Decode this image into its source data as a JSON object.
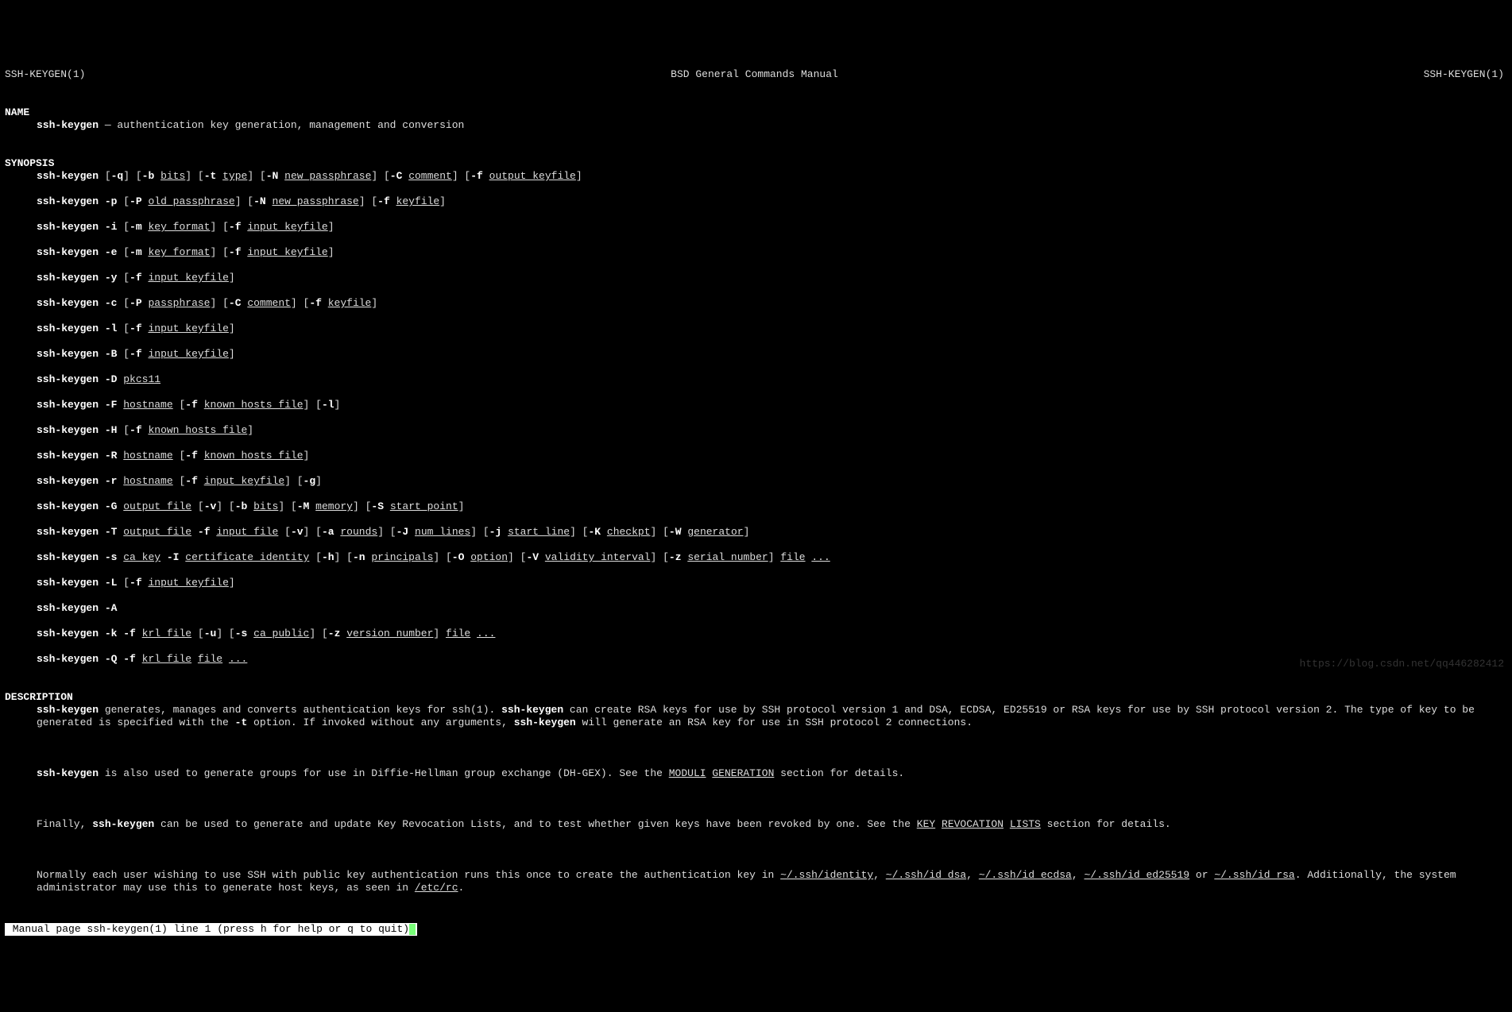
{
  "header": {
    "left": "SSH-KEYGEN(1)",
    "center": "BSD General Commands Manual",
    "right": "SSH-KEYGEN(1)"
  },
  "sections": {
    "name_hdr": "NAME",
    "name_cmd": "ssh-keygen",
    "name_desc": " — authentication key generation, management and conversion",
    "syn_hdr": "SYNOPSIS",
    "desc_hdr": "DESCRIPTION"
  },
  "syn": {
    "cmd": "ssh-keygen",
    "q": "-q",
    "b": "-b",
    "bits": "bits",
    "t": "-t",
    "type": "type",
    "N": "-N",
    "new_pass": "new_passphrase",
    "C": "-C",
    "comment": "comment",
    "f": "-f",
    "out_key": "output_keyfile",
    "p": "-p",
    "P": "-P",
    "old_pass": "old_passphrase",
    "keyfile": "keyfile",
    "i": "-i",
    "m": "-m",
    "key_fmt": "key_format",
    "in_key": "input_keyfile",
    "e": "-e",
    "y": "-y",
    "c": "-c",
    "passphrase": "passphrase",
    "l": "-l",
    "B": "-B",
    "D": "-D",
    "pkcs11": "pkcs11",
    "F": "-F",
    "hostname": "hostname",
    "khf": "known_hosts_file",
    "H": "-H",
    "R": "-R",
    "r": "-r",
    "g": "-g",
    "G": "-G",
    "out_file": "output_file",
    "v": "-v",
    "M": "-M",
    "memory": "memory",
    "S": "-S",
    "start_point": "start_point",
    "T": "-T",
    "in_file": "input_file",
    "a": "-a",
    "rounds": "rounds",
    "J": "-J",
    "num_lines": "num_lines",
    "j": "-j",
    "start_line": "start_line",
    "K": "-K",
    "checkpt": "checkpt",
    "W": "-W",
    "generator": "generator",
    "s": "-s",
    "ca_key": "ca_key",
    "I": "-I",
    "cert_id": "certificate_identity",
    "h": "-h",
    "n": "-n",
    "principals": "principals",
    "O": "-O",
    "option": "option",
    "V": "-V",
    "valid": "validity_interval",
    "z": "-z",
    "serial": "serial_number",
    "file": "file",
    "dots": "...",
    "L": "-L",
    "A": "-A",
    "k": "-k",
    "krl": "krl_file",
    "u": "-u",
    "ca_pub": "ca_public",
    "ver_num": "version_number",
    "Q": "-Q"
  },
  "desc": {
    "p1a": " generates, manages and converts authentication keys for ssh(1).  ",
    "p1b": " can create RSA keys for use by SSH protocol version 1 and DSA, ECDSA, ED25519 or RSA keys for use by SSH protocol version 2.  The type of key to be generated is specified with the ",
    "p1c": " option.  If invoked without any arguments, ",
    "p1d": " will generate an RSA key for use in SSH protocol 2 connections.",
    "dash_t": "-t",
    "p2a": " is also used to generate groups for use in Diffie-Hellman group exchange (DH-GEX).  See the ",
    "p2b": "MODULI",
    "p2c": "GENERATION",
    "p2d": " section for details.",
    "p3a": "Finally, ",
    "p3b": " can be used to generate and update Key Revocation Lists, and to test whether given keys have been revoked by one.  See the ",
    "p3c": "KEY",
    "p3d": "REVOCATION",
    "p3e": "LISTS",
    "p3f": " section for details.",
    "p4a": "Normally each user wishing to use SSH with public key authentication runs this once to create the authentication key in ",
    "p4b": "~/.ssh/identity",
    "p4c": "~/.ssh/id_dsa",
    "p4d": "~/.ssh/id_ecdsa",
    "p4e": "~/.ssh/id_ed25519",
    "p4f": "~/.ssh/id_rsa",
    "p4g": ".  Additionally, the system administrator may use this to generate host keys, as seen in ",
    "p4h": "/etc/rc",
    "p4i": "."
  },
  "status": " Manual page ssh-keygen(1) line 1 (press h for help or q to quit)",
  "watermark": "https://blog.csdn.net/qq446282412"
}
